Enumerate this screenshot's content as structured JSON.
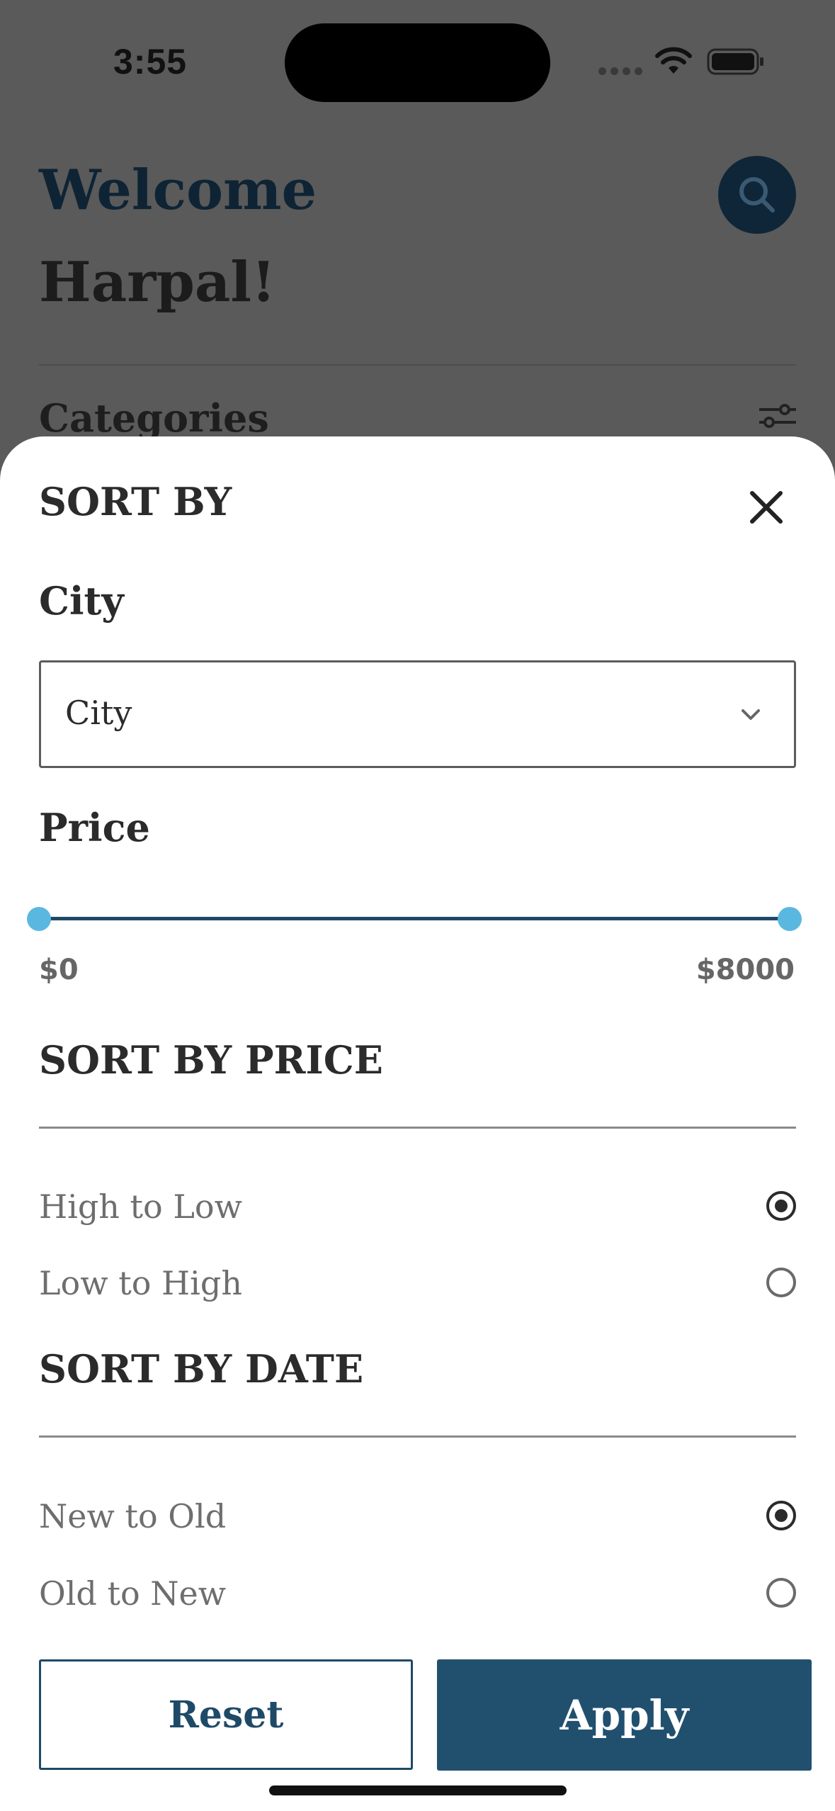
{
  "status_bar": {
    "time": "3:55"
  },
  "home": {
    "welcome_line1": "Welcome",
    "welcome_line2": "Harpal!",
    "categories_label": "Categories"
  },
  "sheet": {
    "title": "SORT BY",
    "city_label": "City",
    "city_select": {
      "value": "City",
      "options": [
        "City"
      ]
    },
    "price_label": "Price",
    "price_slider": {
      "min": 0,
      "max": 8000,
      "low": 0,
      "high": 8000,
      "min_label": "$0",
      "max_label": "$8000"
    },
    "sort_price": {
      "title": "SORT BY PRICE",
      "options": [
        {
          "label": "High to Low",
          "selected": true
        },
        {
          "label": "Low to High",
          "selected": false
        }
      ]
    },
    "sort_date": {
      "title": "SORT BY DATE",
      "options": [
        {
          "label": "New to Old",
          "selected": true
        },
        {
          "label": "Old to New",
          "selected": false
        }
      ]
    },
    "reset_label": "Reset",
    "apply_label": "Apply"
  },
  "colors": {
    "primary": "#21506f",
    "slider_thumb": "#5ab8e0",
    "overlay": "#5a5a5a"
  },
  "icons": [
    "search-icon",
    "filter-icon",
    "close-icon",
    "chevron-down-icon",
    "wifi-icon",
    "battery-icon"
  ]
}
